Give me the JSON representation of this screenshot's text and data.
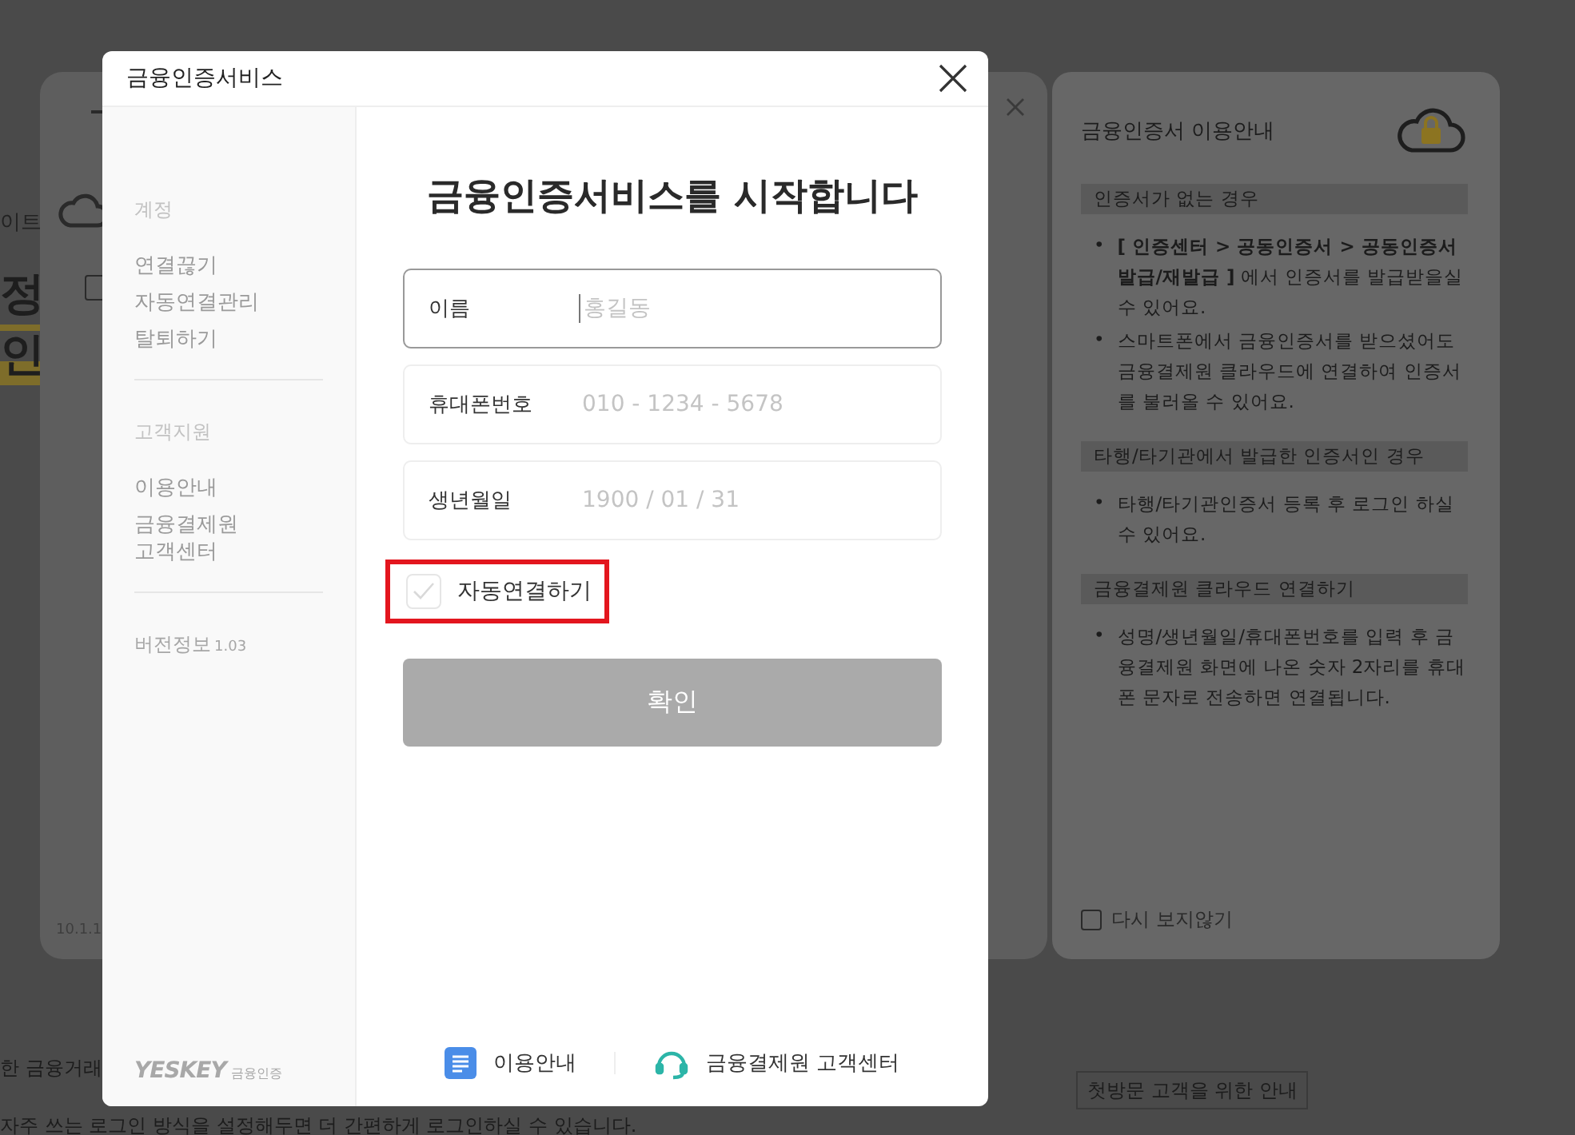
{
  "background_page": {
    "fragments": [
      {
        "kind": "small",
        "text": "이트"
      },
      {
        "kind": "large",
        "text": "정"
      },
      {
        "kind": "large",
        "text": "인"
      }
    ],
    "footer_texts": [
      "한 금융거래",
      "자주 쓰는 로그인 방식을 설정해두면 더 간편하게 로그인하실 수 있습니다."
    ],
    "first_visit_button": "첫방문 고객을 위한 안내"
  },
  "back_dialog": {
    "version": "10.1.1",
    "checkbox_checked": false
  },
  "guide_panel": {
    "title": "금융인증서 이용안내",
    "sections": [
      {
        "heading": "인증서가 없는 경우",
        "bullets": [
          {
            "marker": "•",
            "text": "**[ 인증센터 > 공동인증서 > 공동인증서 발급/재발급 ]** 에서 인증서를 발급받을실 수 있어요."
          },
          {
            "marker": "•",
            "text": "스마트폰에서 금융인증서를 받으셨어도 금융결제원 클라우드에 연결하여 인증서를 불러올 수 있어요."
          }
        ]
      },
      {
        "heading": "타행/타기관에서 발급한 인증서인 경우",
        "bullets": [
          {
            "marker": "•",
            "text": "타행/타기관인증서 등록 후 로그인 하실 수 있어요."
          }
        ]
      },
      {
        "heading": "금융결제원 클라우드 연결하기",
        "bullets": [
          {
            "marker": "•",
            "text": "성명/생년월일/휴대폰번호를 입력 후 금융결제원 화면에 나온 숫자 2자리를 휴대폰 문자로 전송하면 연결됩니다."
          }
        ]
      }
    ],
    "dont_show_again": {
      "label": "다시 보지않기",
      "checked": false
    }
  },
  "window": {
    "title": "금융인증서비스"
  },
  "sidebar": {
    "sections": [
      {
        "heading": "계정",
        "items": [
          "연결끊기",
          "자동연결관리",
          "탈퇴하기"
        ]
      },
      {
        "heading": "고객지원",
        "items": [
          "이용안내",
          "금융결제원\n고객센터"
        ]
      }
    ],
    "version": {
      "label": "버전정보",
      "number": "1.03"
    },
    "logo": {
      "name": "YESKEY",
      "subtitle": "금융인증"
    }
  },
  "main": {
    "heading": "금융인증서비스를 시작합니다",
    "fields": [
      {
        "label": "이름",
        "placeholder": "홍길동",
        "focused": true
      },
      {
        "label": "휴대폰번호",
        "placeholder": "010 - 1234 - 5678",
        "focused": false
      },
      {
        "label": "생년월일",
        "placeholder": "1900 / 01 / 31",
        "focused": false
      }
    ],
    "auto_connect": {
      "label": "자동연결하기",
      "checked": false,
      "highlighted": true
    },
    "confirm_button": {
      "label": "확인",
      "disabled": true
    },
    "footer_links": [
      {
        "kind": "guide",
        "label": "이용안내"
      },
      {
        "kind": "support",
        "label": "금융결제원 고객센터"
      }
    ]
  }
}
